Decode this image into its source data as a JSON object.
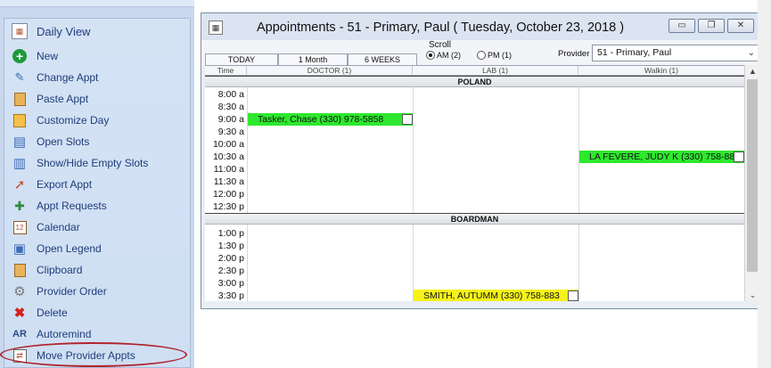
{
  "sidebar": {
    "header": "Daily View",
    "items": [
      {
        "label": "New",
        "icon": "new-icon",
        "glyph": "+",
        "color": "#1c9a3a"
      },
      {
        "label": "Change Appt",
        "icon": "change-appt-icon",
        "glyph": "✎",
        "color": "#3a6db5"
      },
      {
        "label": "Paste Appt",
        "icon": "paste-icon",
        "glyph": "📋",
        "color": "#b07b2c"
      },
      {
        "label": "Customize Day",
        "icon": "customize-day-icon",
        "glyph": "▦",
        "color": "#e2a31c"
      },
      {
        "label": "Open Slots",
        "icon": "open-slots-icon",
        "glyph": "▤",
        "color": "#3a6db5"
      },
      {
        "label": "Show/Hide Empty Slots",
        "icon": "show-hide-slots-icon",
        "glyph": "▥",
        "color": "#3a6db5"
      },
      {
        "label": "Export Appt",
        "icon": "export-icon",
        "glyph": "➚",
        "color": "#c0502a"
      },
      {
        "label": "Appt Requests",
        "icon": "appt-requests-icon",
        "glyph": "✚",
        "color": "#2e8b3a"
      },
      {
        "label": "Calendar",
        "icon": "calendar-icon",
        "glyph": "12",
        "color": "#b5532c"
      },
      {
        "label": "Open Legend",
        "icon": "legend-icon",
        "glyph": "▣",
        "color": "#3a6db5"
      },
      {
        "label": "Clipboard",
        "icon": "clipboard-icon",
        "glyph": "▢",
        "color": "#b07b2c"
      },
      {
        "label": "Provider Order",
        "icon": "gear-icon",
        "glyph": "⚙",
        "color": "#777777"
      },
      {
        "label": "Delete",
        "icon": "delete-icon",
        "glyph": "✖",
        "color": "#d4211b"
      },
      {
        "label": "Autoremind",
        "icon": "autoremind-icon",
        "glyph": "AR",
        "color": "#2b4c86"
      },
      {
        "label": "Move Provider Appts",
        "icon": "move-appts-icon",
        "glyph": "⇄",
        "color": "#555555"
      }
    ]
  },
  "window": {
    "title": "Appointments - 51 - Primary, Paul  ( Tuesday, October 23, 2018 )",
    "buttons": {
      "minimize": "▭",
      "restore": "❐",
      "close": "✕"
    }
  },
  "toolbar": {
    "tabs": [
      "TODAY",
      "1 Month",
      "6 WEEKS"
    ],
    "scroll_label": "Scroll",
    "am_label": "AM (2)",
    "pm_label": "PM (1)",
    "provider_label": "Provider",
    "provider_value": "51 - Primary, Paul"
  },
  "grid": {
    "columns": [
      "Time",
      "DOCTOR (1)",
      "LAB (1)",
      "Walkin (1)"
    ],
    "sections": [
      "POLAND",
      "BOARDMAN"
    ],
    "times_poland": [
      "8:00 a",
      "8:30 a",
      "9:00 a",
      "9:30 a",
      "10:00 a",
      "10:30 a",
      "11:00 a",
      "11:30 a",
      "12:00 p",
      "12:30 p"
    ],
    "times_boardman": [
      "1:00 p",
      "1:30 p",
      "2:00 p",
      "2:30 p",
      "3:00 p",
      "3:30 p"
    ],
    "appointments": [
      {
        "text": "Tasker, Chase   (330) 978-5858",
        "color": "#2ee82e"
      },
      {
        "text": "LA FEVERE, JUDY K  (330) 758-88",
        "color": "#2ee82e"
      },
      {
        "text": "SMITH, AUTUMM   (330) 758-883",
        "color": "#f5f21a"
      }
    ]
  }
}
